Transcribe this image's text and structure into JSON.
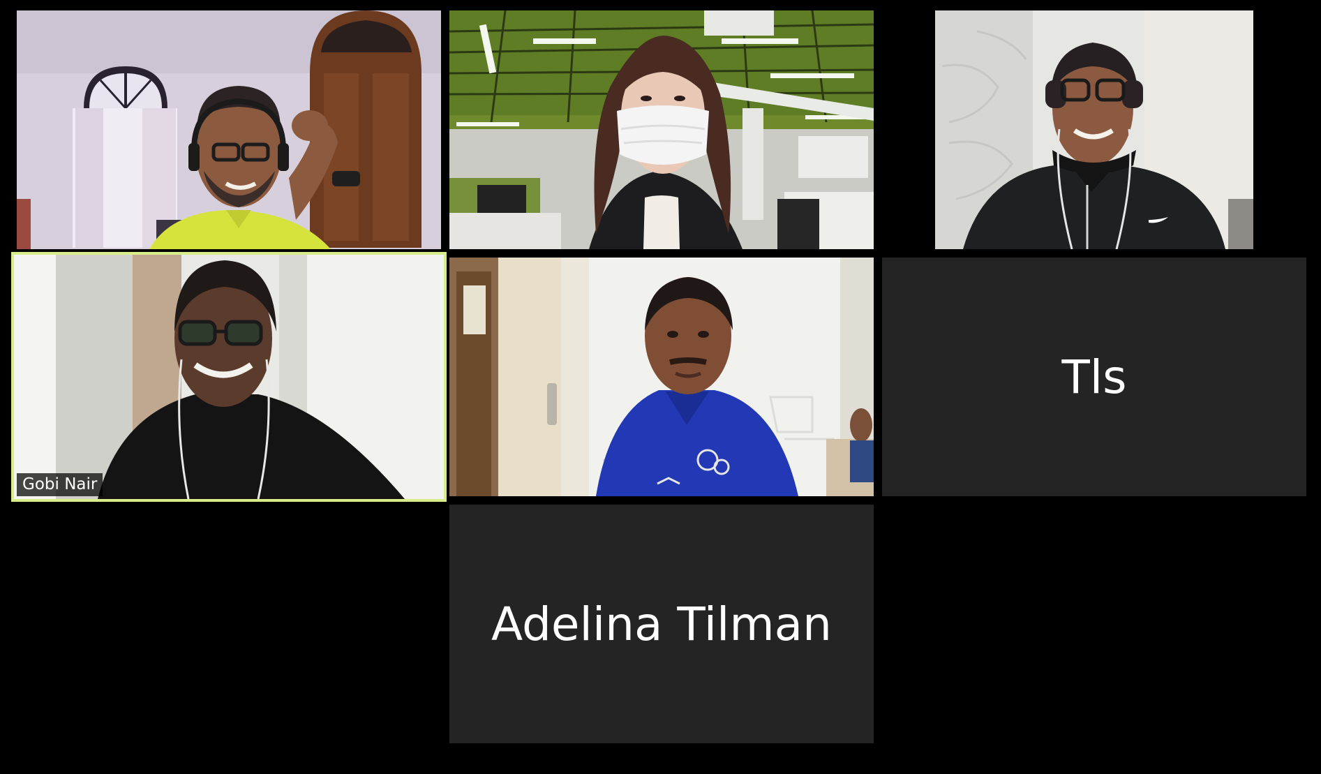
{
  "gallery": {
    "tiles": [
      {
        "id": "video-1",
        "kind": "video",
        "name": ""
      },
      {
        "id": "video-2",
        "kind": "video",
        "name": ""
      },
      {
        "id": "video-3",
        "kind": "video",
        "name": ""
      },
      {
        "id": "video-4",
        "kind": "video",
        "name": "Gobi Nair",
        "active_speaker": true
      },
      {
        "id": "video-5",
        "kind": "video",
        "name": ""
      },
      {
        "id": "name-6",
        "kind": "name",
        "name": "Tls"
      },
      {
        "id": "name-7",
        "kind": "name",
        "name": "Adelina Tilman"
      }
    ]
  },
  "colors": {
    "background": "#000000",
    "tile_background": "#242424",
    "active_speaker_border": "#d9ec8a",
    "text": "#ffffff"
  }
}
